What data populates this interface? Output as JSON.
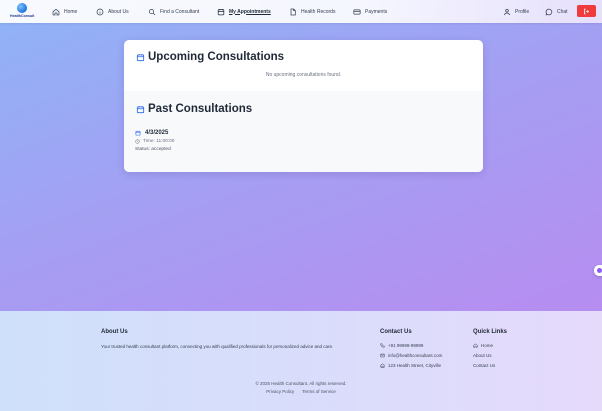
{
  "brand": {
    "logo_text": "HealthConsult"
  },
  "nav": {
    "home": "Home",
    "about": "About Us",
    "find": "Find a Consultant",
    "appointments": "My Appointments",
    "records": "Health Records",
    "payments": "Payments",
    "profile": "Profile",
    "chat": "Chat"
  },
  "upcoming": {
    "title": "Upcoming Consultations",
    "empty_message": "No upcoming consultations found."
  },
  "past": {
    "title": "Past Consultations",
    "items": [
      {
        "date": "4/3/2025",
        "time": "Time: 11:00:00",
        "status": "Status: accepted"
      }
    ]
  },
  "footer": {
    "about_title": "About Us",
    "about_text": "Your trusted health consultant platform, connecting you with qualified professionals for personalized advice and care.",
    "contact_title": "Contact Us",
    "phone": "+91 99999-99999",
    "email": "info@healthconsultant.com",
    "address": "123 Health Street, Cityville",
    "links_title": "Quick Links",
    "links": [
      "Home",
      "About Us",
      "Contact Us"
    ],
    "copyright": "© 2025 Health Consultant. All rights reserved.",
    "privacy": "Privacy Policy",
    "terms": "Terms of Service"
  },
  "colors": {
    "accent": "#2563eb",
    "logout": "#ef3b3b",
    "background_start": "#8fb4f7",
    "background_end": "#bd86f0"
  }
}
